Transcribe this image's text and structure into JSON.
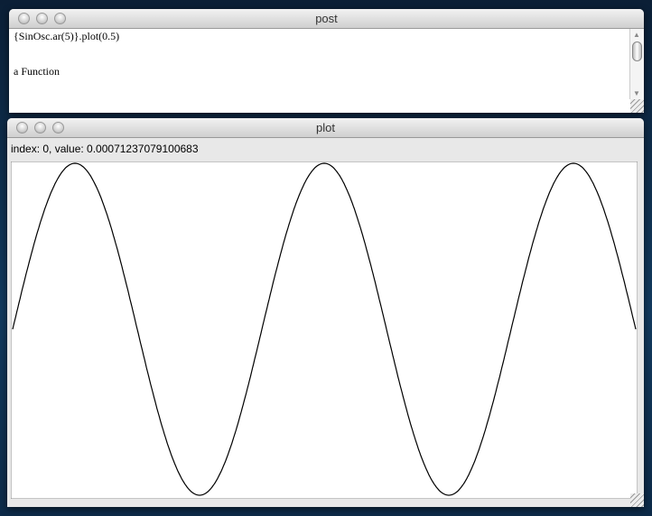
{
  "post": {
    "title": "post",
    "lines": [
      "{SinOsc.ar(5)}.plot(0.5)",
      "",
      "",
      "a Function"
    ]
  },
  "plot": {
    "title": "plot",
    "readout": "index: 0, value: 0.00071237079100683"
  },
  "chart_data": {
    "type": "line",
    "function": "sin",
    "frequency": 5,
    "duration": 0.5,
    "cycles": 2.5,
    "ylim": [
      -1,
      1
    ],
    "grid": false
  }
}
